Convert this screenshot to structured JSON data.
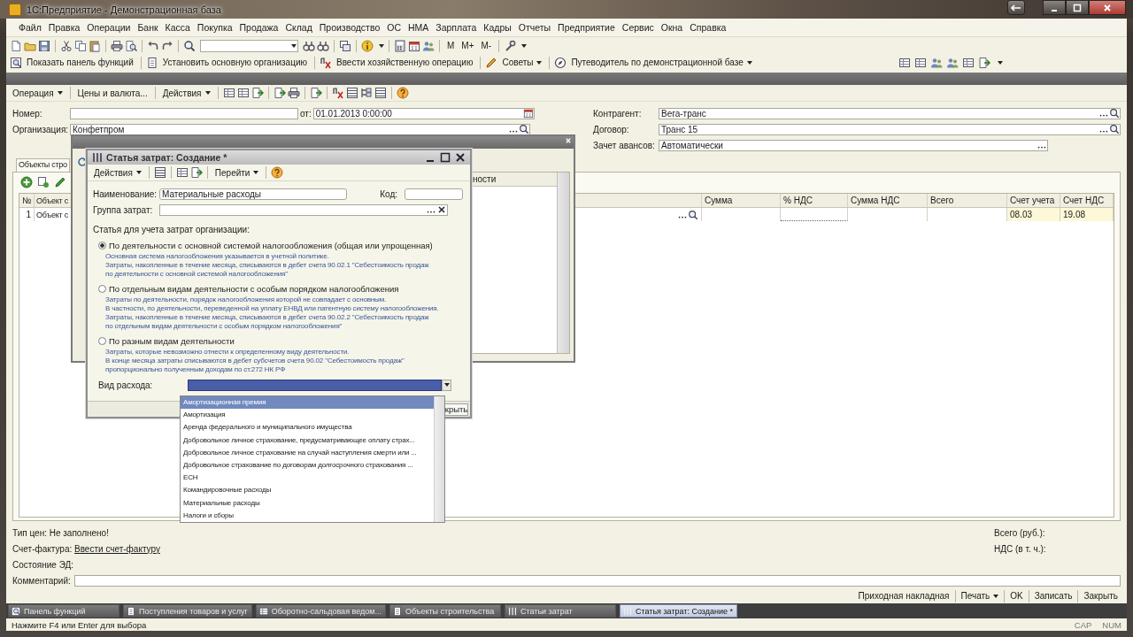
{
  "window": {
    "title": "1С:Предприятие - Демонстрационная база"
  },
  "menu": [
    "Файл",
    "Правка",
    "Операции",
    "Банк",
    "Касса",
    "Покупка",
    "Продажа",
    "Склад",
    "Производство",
    "ОС",
    "НМА",
    "Зарплата",
    "Кадры",
    "Отчеты",
    "Предприятие",
    "Сервис",
    "Окна",
    "Справка"
  ],
  "toolbar": {
    "memory_buttons": [
      "M",
      "M+",
      "M-"
    ]
  },
  "command_bar": [
    {
      "label": "Показать панель функций",
      "dropdown": false
    },
    {
      "label": "Установить основную организацию",
      "dropdown": false
    },
    {
      "label": "Ввести хозяйственную операцию",
      "dropdown": false
    },
    {
      "label": "Советы",
      "dropdown": true
    },
    {
      "label": "Путеводитель по демонстрационной базе",
      "dropdown": true
    }
  ],
  "document": {
    "toolbar": [
      {
        "label": "Операция",
        "dropdown": true
      },
      {
        "label": "Цены и валюта...",
        "dropdown": false
      },
      {
        "label": "Действия",
        "dropdown": true
      }
    ],
    "number": {
      "label": "Номер:"
    },
    "date": {
      "label": "от:",
      "value": "01.01.2013  0:00:00"
    },
    "organization": {
      "label": "Организация:",
      "value": "Конфетпром"
    },
    "counterparty": {
      "label": "Контрагент:",
      "value": "Вега-транс"
    },
    "contract": {
      "label": "Договор:",
      "value": "Транс 15"
    },
    "advance_offset": {
      "label": "Зачет авансов:",
      "value": "Автоматически"
    },
    "tab": {
      "label": "Объекты стро",
      "selected": true
    },
    "table": {
      "columns": [
        "№",
        "Объект с",
        "Сумма",
        "% НДС",
        "Сумма НДС",
        "Всего",
        "Счет учета",
        "Счет НДС"
      ],
      "rows": [
        {
          "number": "1",
          "object": "Объект с",
          "account": "08.03",
          "vat_account": "19.08"
        }
      ]
    },
    "price_type": "Тип цен: Не заполнено!",
    "invoice": {
      "label": "Счет-фактура:",
      "link": "Ввести счет-фактуру"
    },
    "ed_state": {
      "label": "Состояние ЭД:"
    },
    "comment": {
      "label": "Комментарий:"
    },
    "total_label": "Всего (руб.):",
    "vat_label": "НДС (в т. ч.):",
    "buttons": [
      {
        "label": "Приходная накладная",
        "dropdown": false
      },
      {
        "label": "Печать",
        "dropdown": true
      },
      {
        "label": "OK",
        "dropdown": false
      },
      {
        "label": "Записать",
        "dropdown": false
      },
      {
        "label": "Закрыть",
        "dropdown": false
      }
    ]
  },
  "list_window": {
    "column_header": "ности"
  },
  "dialog": {
    "title": "Статья затрат: Создание *",
    "toolbar": [
      {
        "label": "Действия",
        "dropdown": true
      },
      {
        "label": "Перейти",
        "dropdown": true
      }
    ],
    "name": {
      "label": "Наименование:",
      "value": "Материальные расходы"
    },
    "code": {
      "label": "Код:"
    },
    "group": {
      "label": "Группа затрат:"
    },
    "section_title": "Статья для учета затрат организации:",
    "options": [
      {
        "label": "По деятельности с основной системой налогообложения (общая или упрощенная)",
        "selected": true,
        "description_lines": [
          "Основная система налогообложения указывается в учетной политике.",
          "Затраты, накопленные в течение месяца, списываются в дебет счета 90.02.1 \"Себестоимость продаж",
          "по деятельности с основной системой налогообложения\""
        ]
      },
      {
        "label": "По отдельным видам деятельности с особым порядком налогообложения",
        "selected": false,
        "description_lines": [
          "Затраты по деятельности, порядок налогообложения которой не совпадает с основным.",
          "В частности, по деятельности, переведенной на уплату ЕНВД или патентную систему налогообложения.",
          "Затраты, накопленные в течение месяца, списываются в дебет счета 90.02.2 \"Себестоимость продаж",
          "по отдельным видам деятельности с особым порядком налогообложения\""
        ]
      },
      {
        "label": "По разным видам деятельности",
        "selected": false,
        "description_lines": [
          "Затраты, которые невозможно отнести к определенному виду деятельности.",
          "В конце месяца затраты списываются в дебет субсчетов счета 90.02 \"Себестоимость продаж\"",
          "пропорционально полученным доходам по ст.272 НК РФ"
        ]
      }
    ],
    "expense_type": {
      "label": "Вид расхода:"
    },
    "close_button": "крыть"
  },
  "dropdown": {
    "items": [
      {
        "label": "Амортизационная премия",
        "selected": true
      },
      {
        "label": "Амортизация",
        "selected": false
      },
      {
        "label": "Аренда федерального и муниципального имущества",
        "selected": false
      },
      {
        "label": "Добровольное личное страхование, предусматривающее оплату страх...",
        "selected": false
      },
      {
        "label": "Добровольное личное страхование на случай наступления смерти или ...",
        "selected": false
      },
      {
        "label": "Добровольное страхование по договорам долгосрочного страхования ...",
        "selected": false
      },
      {
        "label": "ЕСН",
        "selected": false
      },
      {
        "label": "Командировочные расходы",
        "selected": false
      },
      {
        "label": "Материальные расходы",
        "selected": false
      },
      {
        "label": "Налоги и сборы",
        "selected": false
      }
    ]
  },
  "taskbar": [
    {
      "label": "Панель функций",
      "selected": false
    },
    {
      "label": "Поступления товаров и услуг",
      "selected": false
    },
    {
      "label": "Оборотно-сальдовая ведом...",
      "selected": false
    },
    {
      "label": "Объекты строительства",
      "selected": false
    },
    {
      "label": "Статьи затрат",
      "selected": false
    },
    {
      "label": "Статья затрат: Создание *",
      "selected": true
    }
  ],
  "status_bar": {
    "hint": "Нажмите F4 или Enter для выбора",
    "indicators": [
      "CAP",
      "NUM"
    ]
  }
}
